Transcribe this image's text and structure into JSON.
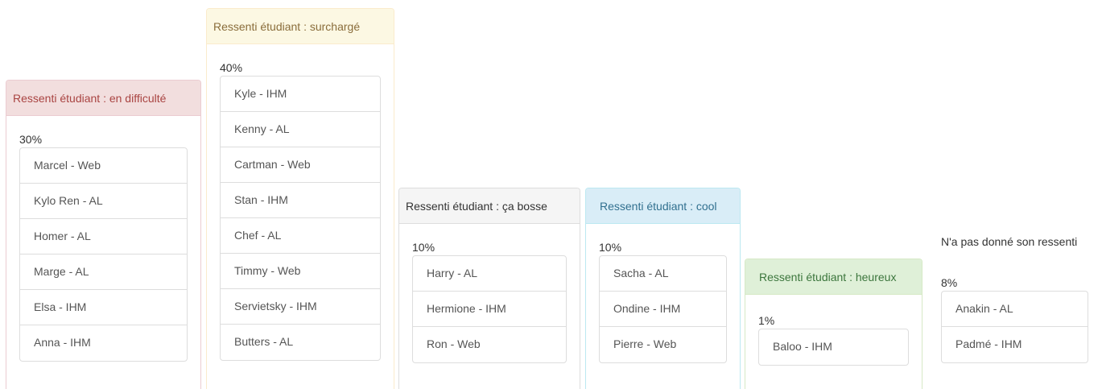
{
  "columns": [
    {
      "title": "Ressenti étudiant : en difficulté",
      "percent": "30%",
      "items": [
        "Marcel - Web",
        "Kylo Ren - AL",
        "Homer - AL",
        "Marge - AL",
        "Elsa - IHM",
        "Anna - IHM"
      ]
    },
    {
      "title": "Ressenti étudiant : surchargé",
      "percent": "40%",
      "items": [
        "Kyle - IHM",
        "Kenny - AL",
        "Cartman - Web",
        "Stan - IHM",
        "Chef - AL",
        "Timmy - Web",
        "Servietsky - IHM",
        "Butters - AL"
      ]
    },
    {
      "title": "Ressenti étudiant : ça bosse",
      "percent": "10%",
      "items": [
        "Harry - AL",
        "Hermione - IHM",
        "Ron - Web"
      ]
    },
    {
      "title": "Ressenti étudiant : cool",
      "percent": "10%",
      "items": [
        "Sacha - AL",
        "Ondine - IHM",
        "Pierre - Web"
      ]
    },
    {
      "title": "Ressenti étudiant : heureux",
      "percent": "1%",
      "items": [
        "Baloo - IHM"
      ]
    },
    {
      "title": "N'a pas donné son ressenti",
      "percent": "8%",
      "items": [
        "Anakin - AL",
        "Padmé - IHM"
      ]
    }
  ],
  "colors": {
    "danger_bg": "#f2dede",
    "warning_bg": "#fcf8e3",
    "default_bg": "#f5f5f5",
    "info_bg": "#d9edf7",
    "success_bg": "#dff0d8"
  }
}
